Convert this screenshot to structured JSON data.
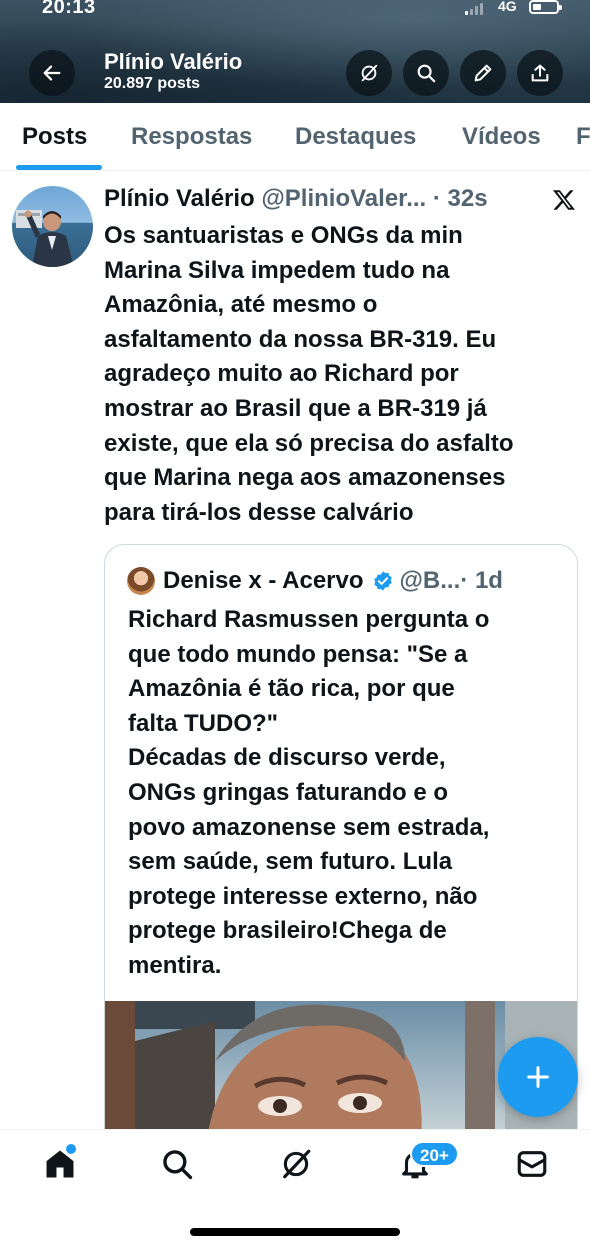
{
  "status_bar": {
    "time": "20:13",
    "network": "4G"
  },
  "header": {
    "name": "Plínio Valério",
    "post_count": "20.897 posts"
  },
  "tabs": [
    {
      "label": "Posts",
      "active": true
    },
    {
      "label": "Respostas"
    },
    {
      "label": "Destaques"
    },
    {
      "label": "Vídeos"
    },
    {
      "label": "F"
    }
  ],
  "post": {
    "author": "Plínio Valério",
    "handle": "@PlinioValer...",
    "time": "· 32s",
    "text": "Os santuaristas  e ONGs da min\nMarina Silva impedem tudo na\nAmazônia, até mesmo o\nasfaltamento da nossa BR-319. Eu\nagradeço muito ao  Richard por\nmostrar  ao Brasil que a BR-319 já\nexiste, que ela só precisa do asfalto\nque Marina nega aos amazonenses\npara tirá-los desse calvário",
    "quote": {
      "author": "Denise x - Acervo",
      "handle": "@B...",
      "time": "· 1d",
      "text": "Richard Rasmussen pergunta o\nque todo mundo pensa: \"Se a\nAmazônia é tão rica, por que\nfalta TUDO?\"\nDécadas de discurso verde,\nONGs gringas faturando e o\npovo amazonense sem estrada,\nsem saúde, sem futuro. Lula\nprotege interesse externo, não\nprotege brasileiro!Chega de\nmentira."
    }
  },
  "bottom_nav": {
    "notifications_badge": "20+"
  },
  "colors": {
    "accent": "#1d9bf0",
    "text": "#0f1419",
    "secondary": "#536471"
  }
}
